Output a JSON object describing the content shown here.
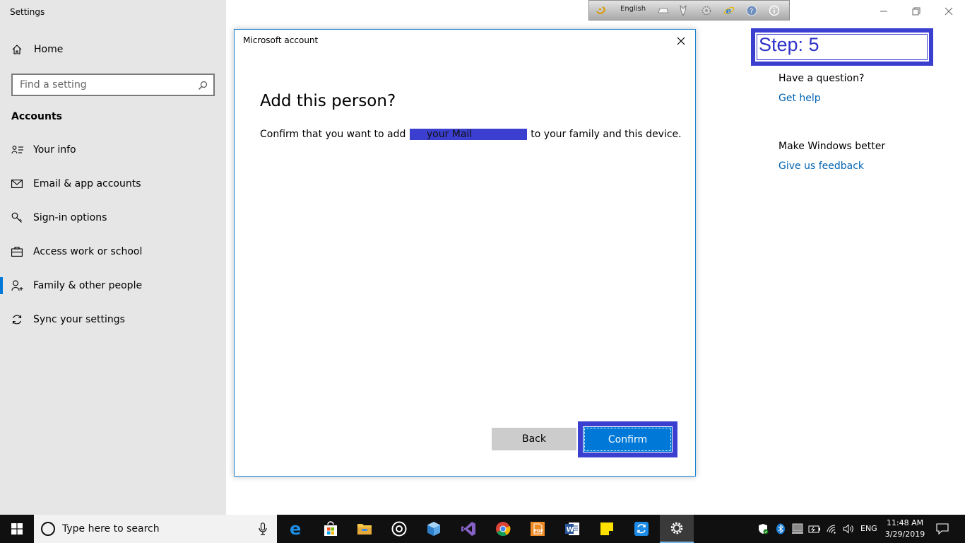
{
  "app": {
    "title": "Settings"
  },
  "sidebar": {
    "home_label": "Home",
    "search_placeholder": "Find a setting",
    "section_title": "Accounts",
    "items": [
      {
        "label": "Your info",
        "icon": "person-card-icon"
      },
      {
        "label": "Email & app accounts",
        "icon": "mail-icon"
      },
      {
        "label": "Sign-in options",
        "icon": "key-icon"
      },
      {
        "label": "Access work or school",
        "icon": "briefcase-icon"
      },
      {
        "label": "Family & other people",
        "icon": "add-person-icon",
        "active": true
      },
      {
        "label": "Sync your settings",
        "icon": "sync-icon"
      }
    ]
  },
  "floating_toolbar": {
    "language": "English"
  },
  "step": {
    "label": "Step: 5"
  },
  "help": {
    "question": "Have a question?",
    "get_help": "Get help",
    "feedback_heading": "Make Windows better",
    "feedback_link": "Give us feedback"
  },
  "dialog": {
    "title": "Microsoft account",
    "heading": "Add this person?",
    "message_before": "Confirm that you want to add",
    "mail_placeholder": "your Mail",
    "message_after": "to your family and this device.",
    "back_label": "Back",
    "confirm_label": "Confirm"
  },
  "taskbar": {
    "search_placeholder": "Type here to search",
    "language": "ENG",
    "time": "11:48 AM",
    "date": "3/29/2019"
  },
  "colors": {
    "accent": "#0078d7",
    "annotation": "#3b3fcf",
    "link": "#0063b1",
    "sidebar_bg": "#e6e6e6"
  }
}
